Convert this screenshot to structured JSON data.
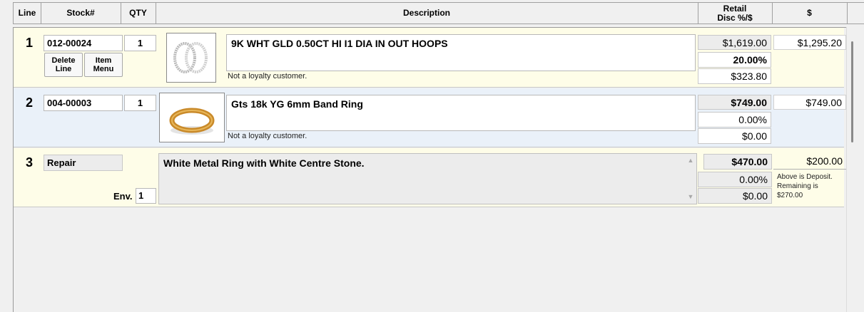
{
  "header": {
    "line": "Line",
    "stock": "Stock#",
    "qty": "QTY",
    "description": "Description",
    "retail_line1": "Retail",
    "retail_line2": "Disc %/$",
    "amount": "$"
  },
  "rows": [
    {
      "line": "1",
      "stock": "012-00024",
      "qty": "1",
      "delete_line_1": "Delete",
      "delete_line_2": "Line",
      "item_menu_1": "Item",
      "item_menu_2": "Menu",
      "image_icon": "hoop-earrings-image",
      "description": "9K WHT GLD 0.50CT HI I1 DIA IN OUT HOOPS",
      "note": "Not a loyalty customer.",
      "retail": "$1,619.00",
      "disc_pct": "20.00%",
      "disc_amt": "$323.80",
      "amount": "$1,295.20"
    },
    {
      "line": "2",
      "stock": "004-00003",
      "qty": "1",
      "image_icon": "gold-band-ring-image",
      "description": "Gts 18k YG 6mm Band Ring",
      "note": "Not a loyalty customer.",
      "retail": "$749.00",
      "disc_pct": "0.00%",
      "disc_amt": "$0.00",
      "amount": "$749.00"
    },
    {
      "line": "3",
      "stock": "Repair",
      "env_label": "Env.",
      "env_value": "1",
      "description": "White Metal Ring with White Centre Stone.",
      "retail": "$470.00",
      "disc_pct": "0.00%",
      "disc_amt": "$0.00",
      "amount": "$200.00",
      "deposit_note_1": "Above is Deposit.",
      "deposit_note_2": "Remaining is",
      "deposit_note_3": "$270.00"
    }
  ]
}
